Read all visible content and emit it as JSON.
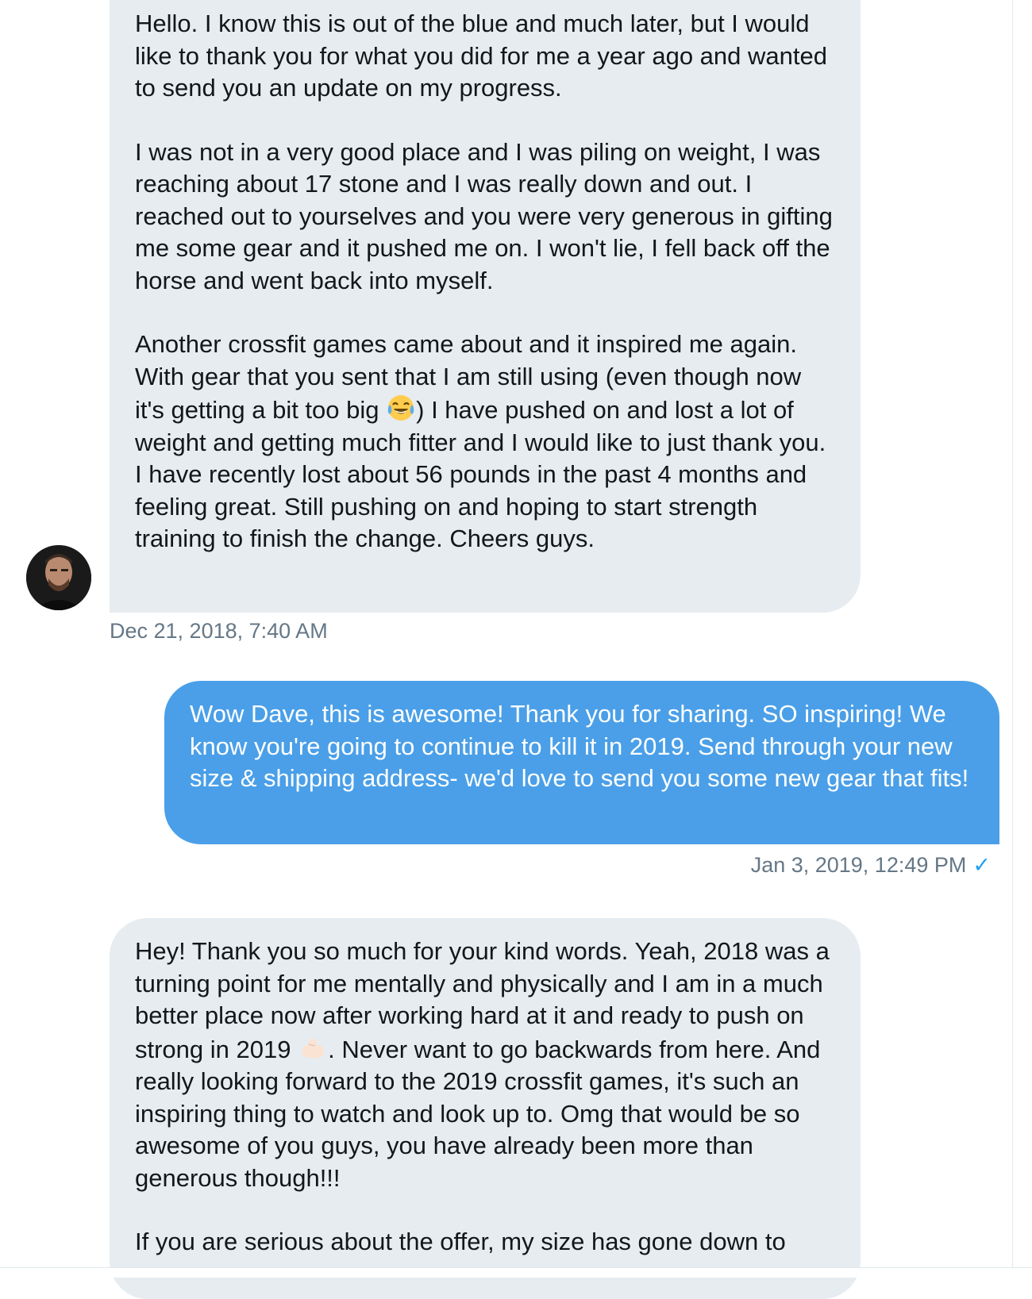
{
  "conversation": {
    "messages": [
      {
        "sender": "received",
        "paragraphs": [
          "Hello. I know this is out of the blue and much later, but I would like to thank you for what you did for me a year ago and wanted to send you an update on my progress.",
          "I was not in a very good place and I was piling on weight, I was reaching about 17 stone and I was really down and out. I reached out to yourselves and you were very generous in gifting me some gear and it pushed me on. I won't lie, I fell back off the horse and went back into myself.",
          "Another crossfit games came about and it inspired me again. With gear that you sent that I am still using (even though now it's getting a bit too big",
          ") I have pushed on and lost a lot of weight and getting much fitter and I would like to just thank you. I have recently lost about 56 pounds in the past 4 months and feeling great. Still pushing on and hoping to start strength training to finish the change. Cheers guys."
        ],
        "timestamp": "Dec 21, 2018, 7:40 AM",
        "emoji": "tears-of-joy-emoji"
      },
      {
        "sender": "sent",
        "text": "Wow Dave, this is awesome! Thank you for sharing. SO inspiring! We know you're going to continue to kill it in 2019. Send through your new size & shipping address- we'd love to send you some new gear that fits!",
        "timestamp": "Jan 3, 2019, 12:49 PM",
        "read_receipt": "✓"
      },
      {
        "sender": "received",
        "paragraphs": [
          "Hey! Thank you so much for your kind words. Yeah, 2018 was a turning point for me mentally and physically and I am in a much better place now after working hard at it and ready to push on strong in 2019",
          ". Never want to go backwards from here. And really looking forward to the 2019 crossfit games, it's such an inspiring thing to watch and look up to. Omg that would be so awesome of you guys, you have already been more than generous though!!!",
          "If you are serious about the offer, my size has gone down to"
        ],
        "emoji": "flexed-biceps-emoji"
      }
    ]
  },
  "colors": {
    "received_bubble": "#e6ecf0",
    "sent_bubble": "#4a9fe8",
    "timestamp": "#657786",
    "read_check": "#1da1f2"
  }
}
